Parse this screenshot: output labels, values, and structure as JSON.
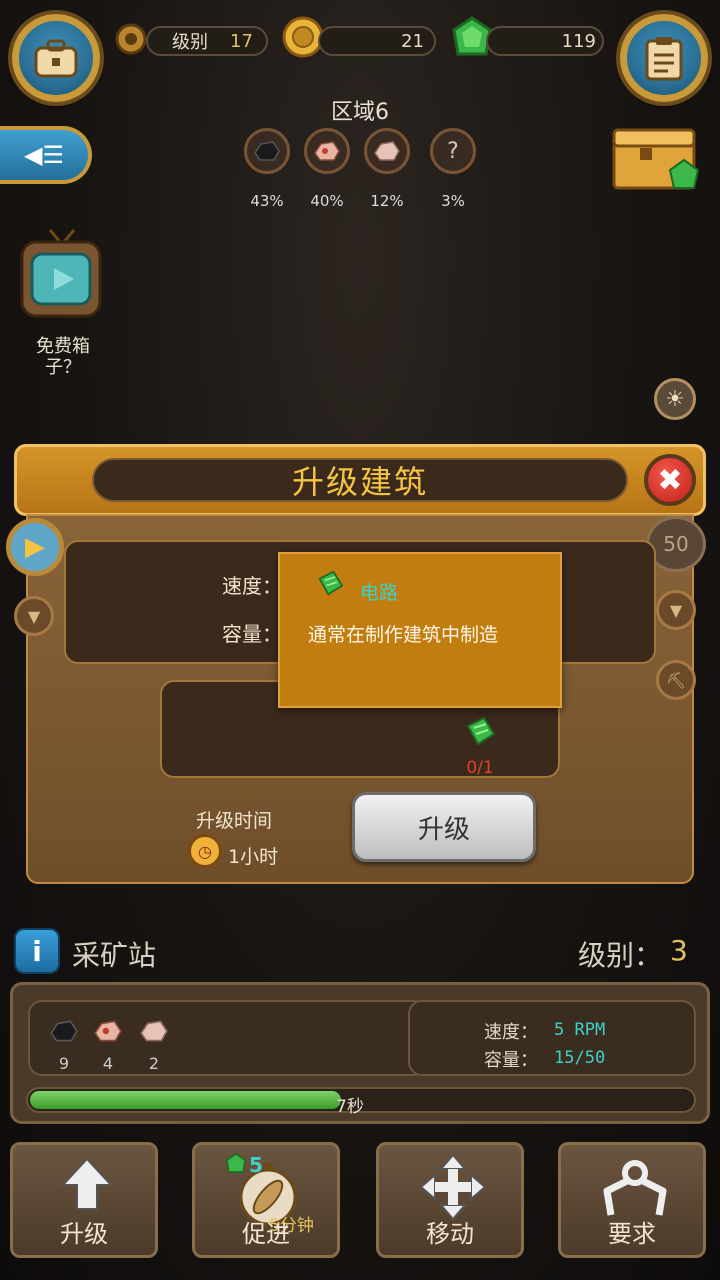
{
  "hud": {
    "level_label": "级别",
    "level_value": "17",
    "coins": "21",
    "gems": "119"
  },
  "zone": {
    "title": "区域6",
    "ores": [
      {
        "icon": "coal-ore-icon",
        "pct": "43%"
      },
      {
        "icon": "copper-ore-icon",
        "pct": "40%"
      },
      {
        "icon": "iron-ore-icon",
        "pct": "12%"
      },
      {
        "icon": "unknown-ore-icon",
        "symbol": "?",
        "pct": "3%"
      }
    ]
  },
  "free_box": {
    "label_line1": "免费箱",
    "label_line2": "子？"
  },
  "upgrade_dialog": {
    "title": "升级建筑",
    "close_symbol": "✖",
    "speed_label": "速度：",
    "capacity_label": "容量：",
    "side_counter": "50",
    "requirement_count": "0/1",
    "time_label": "升级时间",
    "time_value": "1小时",
    "upgrade_button": "升级",
    "tooltip": {
      "item_name": "电路",
      "description": "通常在制作建筑中制造"
    }
  },
  "station": {
    "name": "采矿站",
    "level_label": "级别：",
    "level_value": "3",
    "ore_counts": [
      "9",
      "4",
      "2"
    ],
    "speed_label": "速度：",
    "speed_value": "5 RPM",
    "capacity_label": "容量：",
    "capacity_value": "15/50",
    "timer": "7秒",
    "progress": 0.47
  },
  "actions": {
    "upgrade": "升级",
    "boost": "促进",
    "boost_gem_cost": "5",
    "boost_time": "5分钟",
    "move": "移动",
    "require": "要求"
  },
  "colors": {
    "accent_gold": "#f5c542",
    "panel_orange": "#d6952a",
    "gem_green": "#3cb84a",
    "progress_green": "#5cbf48",
    "teal_text": "#3fd0c8"
  }
}
